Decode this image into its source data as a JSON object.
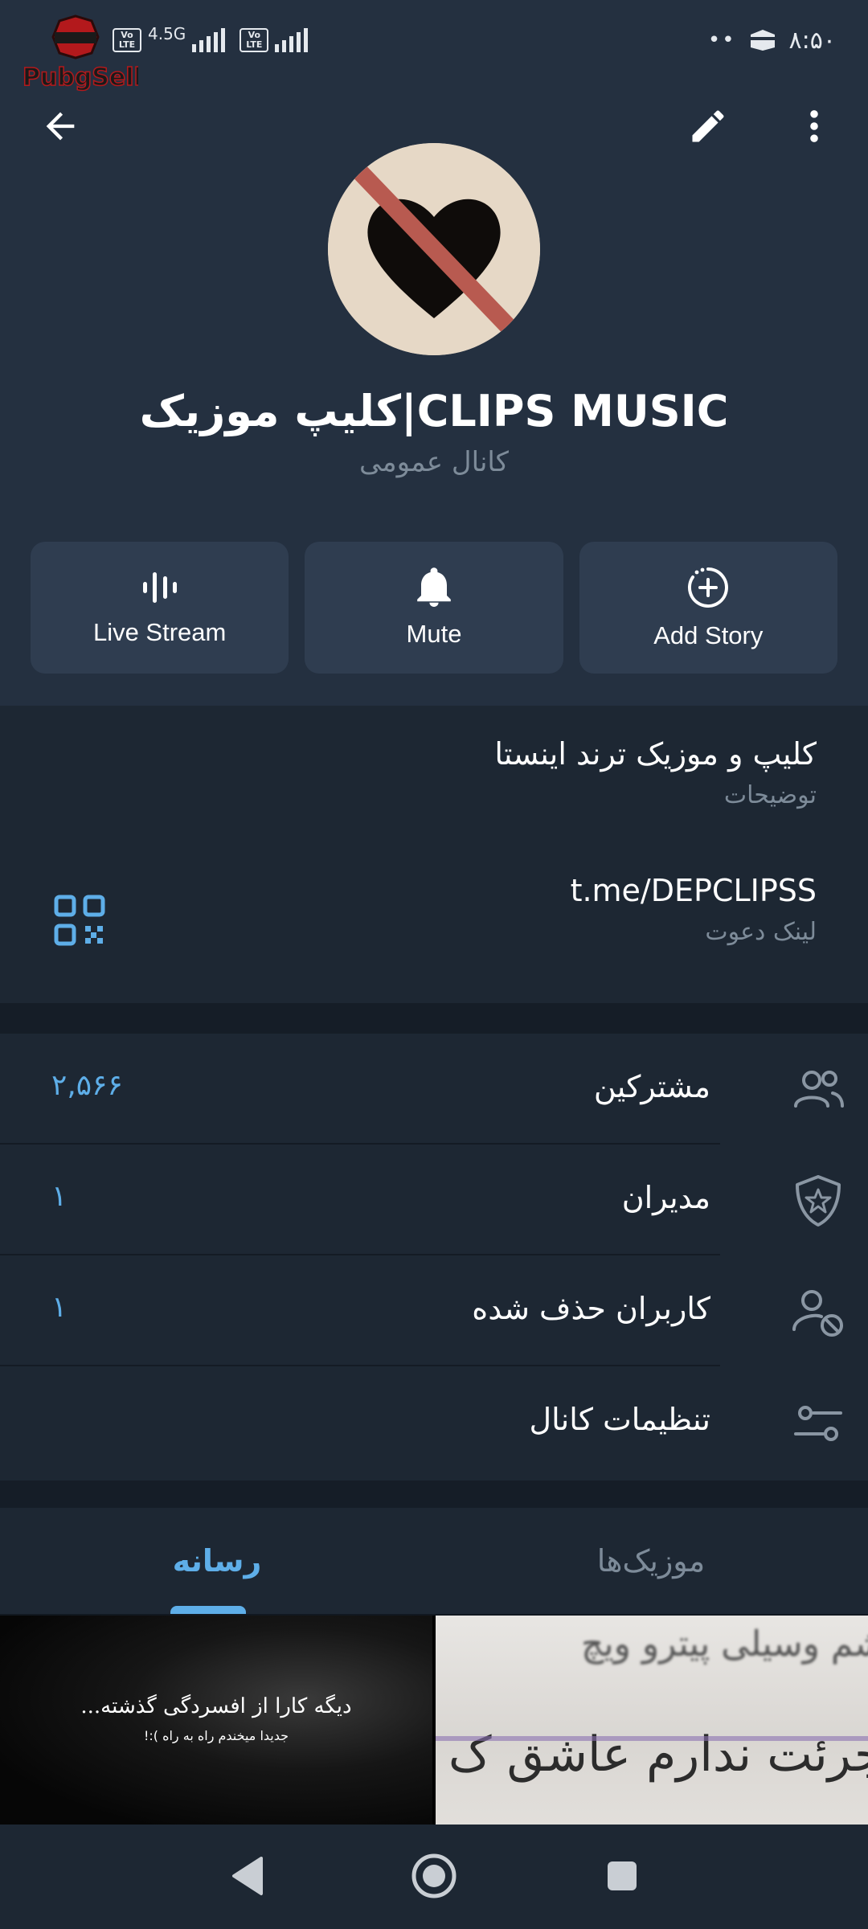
{
  "status_bar": {
    "watermark": "PubgSell",
    "network_type": "4.5G",
    "volte_label_top": "Vo",
    "volte_label_bottom": "LTE",
    "time": "۸:۵۰",
    "dots": "••"
  },
  "header": {
    "channel_name": "کلیپ موزیک|CLIPS MUSIC",
    "channel_type": "کانال عمومی"
  },
  "actions": [
    {
      "label": "Live Stream",
      "icon": "live-stream-icon"
    },
    {
      "label": "Mute",
      "icon": "bell-icon"
    },
    {
      "label": "Add Story",
      "icon": "add-story-icon"
    }
  ],
  "info": {
    "description": "کلیپ و موزیک ترند اینستا",
    "description_label": "توضیحات",
    "link": "t.me/DEPCLIPSS",
    "link_label": "لینک دعوت"
  },
  "list": [
    {
      "label": "مشترکین",
      "count": "۲,۵۶۶",
      "icon": "subscribers-icon"
    },
    {
      "label": "مدیران",
      "count": "۱",
      "icon": "admins-icon"
    },
    {
      "label": "کاربران حذف شده",
      "count": "۱",
      "icon": "removed-users-icon"
    },
    {
      "label": "تنظیمات کانال",
      "count": "",
      "icon": "settings-sliders-icon"
    }
  ],
  "tabs": {
    "media": "رسانه",
    "music": "موزیک‌ها"
  },
  "media": {
    "item1_caption": "دیگه کارا از افسردگی گذشته...",
    "item1_subcaption": "جدیدا میخندم راه به راه ):!",
    "item2_text_top": "شم وسیلی پیترو ویچ",
    "item2_text_bottom": "جرئت ندارم عاشق ک"
  },
  "colors": {
    "accent": "#5eaee8",
    "header_bg": "#243040",
    "page_bg": "#1d2733",
    "button_bg": "#2f3d50"
  }
}
